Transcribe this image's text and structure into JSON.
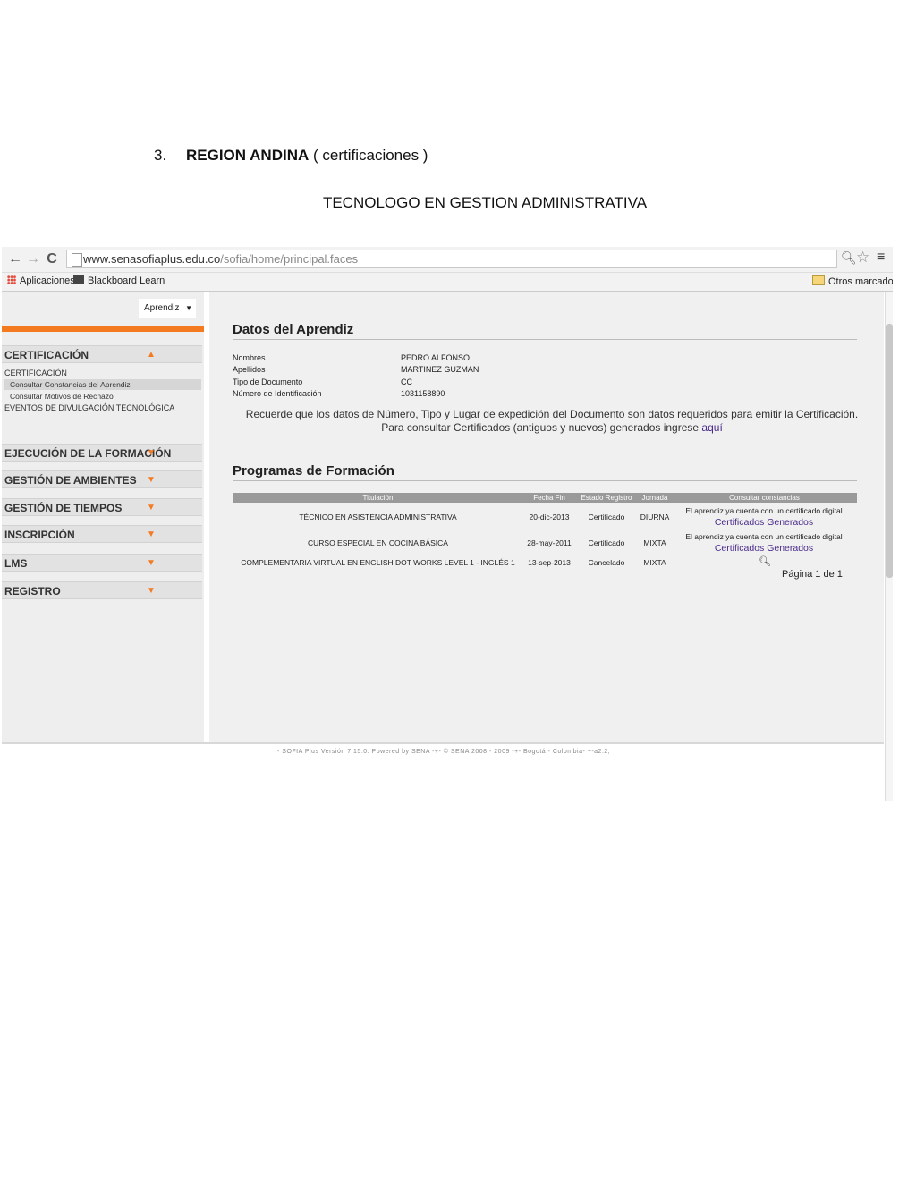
{
  "document": {
    "number": "3.",
    "heading_bold": "REGION ANDINA",
    "heading_rest": " ( certificaciones )",
    "subtitle": "TECNOLOGO EN GESTION ADMINISTRATIVA"
  },
  "browser": {
    "url_main": "www.senasofiaplus.edu.co",
    "url_path": "/sofia/home/principal.faces",
    "bookmarks": {
      "apps": "Aplicaciones",
      "blackboard": "Blackboard Learn",
      "other": "Otros marcadores"
    },
    "icons": [
      "back-icon",
      "forward-icon",
      "reload-icon",
      "page-icon",
      "zoom-icon",
      "star-icon",
      "menu-icon",
      "apps-icon",
      "blackboard-icon",
      "folder-icon"
    ]
  },
  "sidebar": {
    "role": "Aprendiz",
    "certificacion": {
      "title": "CERTIFICACIÓN",
      "heading": "CERTIFICACIÓN",
      "items": [
        "Consultar Constancias del Aprendiz",
        "Consultar Motivos de Rechazo"
      ],
      "eventos": "EVENTOS DE DIVULGACIÓN TECNOLÓGICA"
    },
    "sections": [
      "EJECUCIÓN DE LA FORMACIÓN",
      "GESTIÓN DE AMBIENTES",
      "GESTIÓN DE TIEMPOS",
      "INSCRIPCIÓN",
      "LMS",
      "REGISTRO"
    ],
    "accent": "#f47a20"
  },
  "datos": {
    "title": "Datos del Aprendiz",
    "labels": [
      "Nombres",
      "Apellidos",
      "Tipo de Documento",
      "Número de Identificación"
    ],
    "values": [
      "PEDRO ALFONSO",
      "MARTINEZ GUZMAN",
      "CC",
      "1031158890"
    ],
    "notice": "Recuerde que los datos de Número, Tipo y Lugar de expedición del Documento son datos requeridos para emitir la Certificación. Para consultar Certificados (antiguos y nuevos) generados ingrese",
    "notice_link": "aquí"
  },
  "programas": {
    "title": "Programas de Formación",
    "headers": [
      "Titulación",
      "Fecha Fin",
      "Estado Registro",
      "Jornada",
      "Consultar constancias"
    ],
    "rows": [
      {
        "titulacion": "TÉCNICO EN ASISTENCIA ADMINISTRATIVA",
        "fecha": "20-dic-2013",
        "estado": "Certificado",
        "jornada": "DIURNA",
        "note": "El aprendiz ya cuenta con un certificado digital",
        "link": "Certificados Generados"
      },
      {
        "titulacion": "CURSO ESPECIAL EN COCINA BÁSICA",
        "fecha": "28-may-2011",
        "estado": "Certificado",
        "jornada": "MIXTA",
        "note": "El aprendiz ya cuenta con un certificado digital",
        "link": "Certificados Generados"
      },
      {
        "titulacion": "COMPLEMENTARIA VIRTUAL EN ENGLISH DOT WORKS LEVEL 1 - INGLÉS 1",
        "fecha": "13-sep-2013",
        "estado": "Cancelado",
        "jornada": "MIXTA"
      }
    ],
    "pager": "Página 1 de 1"
  },
  "footer": "- SOFIA Plus Versión 7.15.0. Powered by SENA -+- © SENA 2008 - 2009 -+- Bogotá - Colombia- +-a2.2;"
}
